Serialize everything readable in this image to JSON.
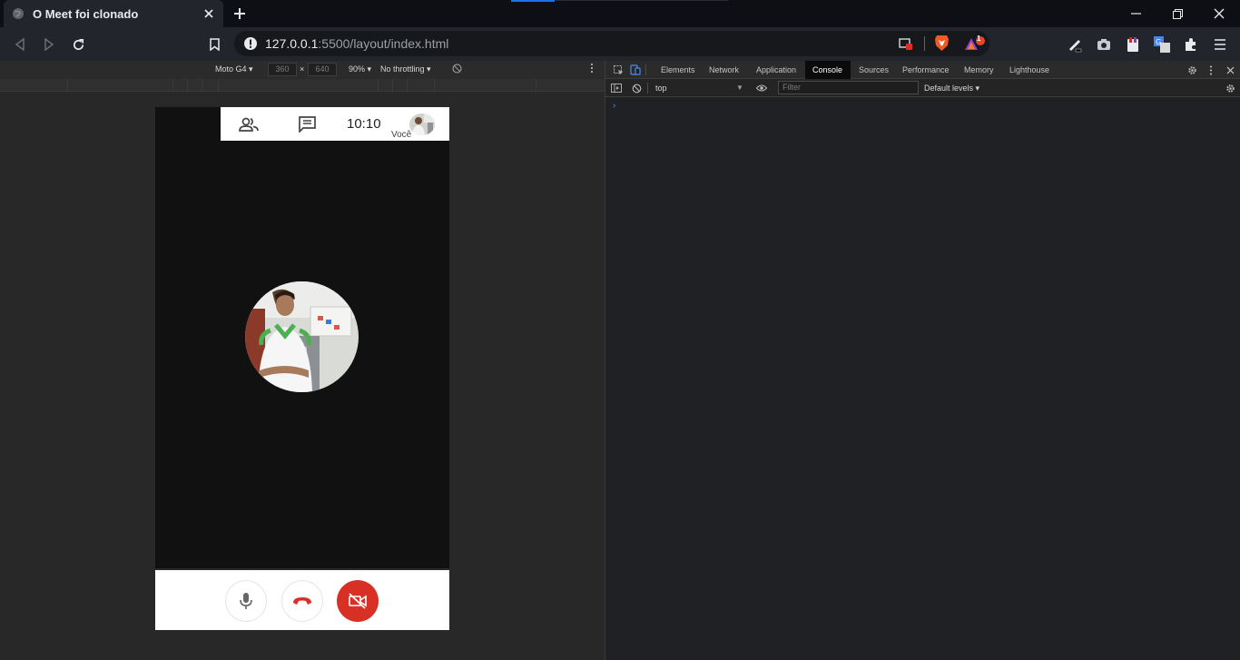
{
  "tab": {
    "title": "O Meet foi clonado"
  },
  "address_bar": {
    "host": "127.0.0.1",
    "rest": ":5500/layout/index.html"
  },
  "extensions": {
    "badge_count": "1"
  },
  "device_toolbar": {
    "device": "Moto G4",
    "width": "360",
    "times": "×",
    "height": "640",
    "zoom": "90%",
    "throttling": "No throttling"
  },
  "meet": {
    "time": "10:10",
    "you_label": "Você"
  },
  "devtools": {
    "tabs": [
      "Elements",
      "Network",
      "Application",
      "Console",
      "Sources",
      "Performance",
      "Memory",
      "Lighthouse"
    ],
    "active_tab": "Console",
    "context": "top",
    "filter_placeholder": "Filter",
    "levels": "Default levels",
    "prompt": "›"
  },
  "colors": {
    "accent": "#1a73e8",
    "meet_red": "#d93025",
    "active_tab_bg": "#0b0b0b"
  }
}
